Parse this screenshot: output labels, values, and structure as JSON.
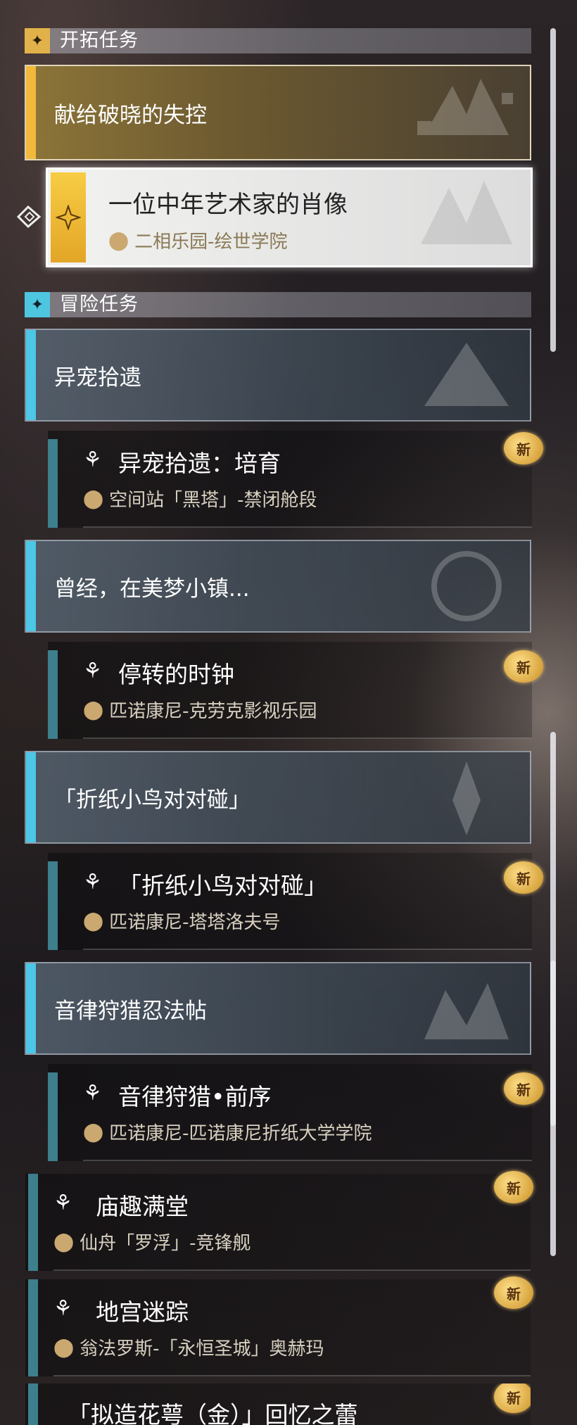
{
  "sections": {
    "trailblaze": {
      "title": "开拓任务",
      "icon": "star-emblem-icon"
    },
    "adventure": {
      "title": "冒险任务",
      "icon": "star-compass-icon"
    }
  },
  "trailblaze_group": {
    "name": "献给破晓的失控"
  },
  "trailblaze_active": {
    "name": "一位中年艺术家的肖像",
    "location": "二相乐园-绘世学院"
  },
  "groups": [
    {
      "name": "异宠拾遗",
      "quest": {
        "name": "异宠拾遗：培育",
        "location": "空间站「黑塔」-禁闭舱段",
        "badge": "新"
      }
    },
    {
      "name": "曾经，在美梦小镇...",
      "quest": {
        "name": "停转的时钟",
        "location": "匹诺康尼-克劳克影视乐园",
        "badge": "新"
      }
    },
    {
      "name": "「折纸小鸟对对碰」",
      "quest": {
        "name": "「折纸小鸟对对碰」",
        "location": "匹诺康尼-塔塔洛夫号",
        "badge": "新"
      }
    },
    {
      "name": "音律狩猎忍法帖",
      "quest": {
        "name": "音律狩猎•前序",
        "location": "匹诺康尼-匹诺康尼折纸大学学院",
        "badge": "新"
      }
    }
  ],
  "extra_quests": [
    {
      "name": "庙趣满堂",
      "location": "仙舟「罗浮」-竞锋舰",
      "badge": "新"
    },
    {
      "name": "地宫迷踪",
      "location": "翁法罗斯-「永恒圣城」奥赫玛",
      "badge": "新"
    },
    {
      "name": "「拟造花萼（金）」回忆之蕾",
      "location": "",
      "badge": "新"
    }
  ]
}
